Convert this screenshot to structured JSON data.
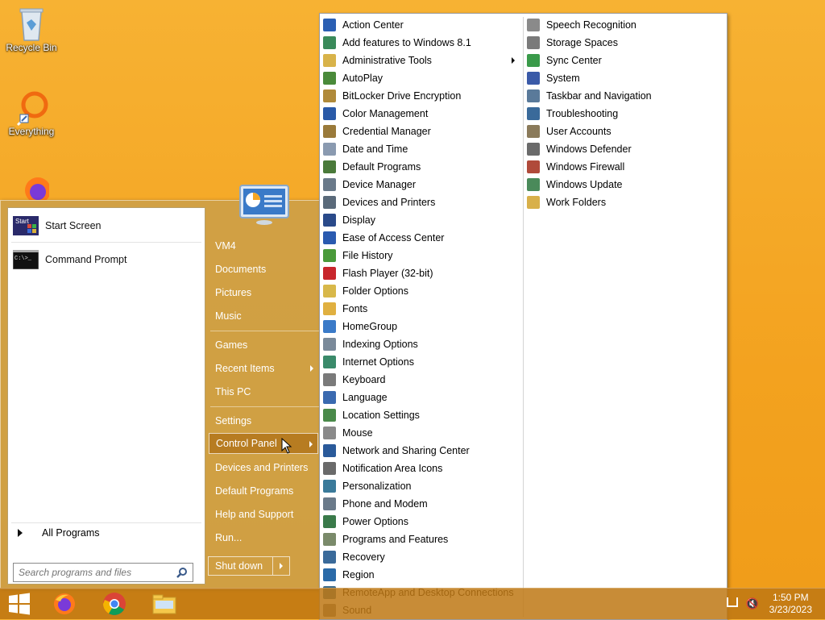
{
  "desktop": {
    "icons": [
      {
        "label": "Recycle Bin",
        "icon": "recycle-bin-icon"
      },
      {
        "label": "Everything",
        "icon": "everything-search-icon"
      },
      {
        "label": "",
        "icon": "firefox-icon"
      }
    ]
  },
  "start_menu": {
    "pinned": [
      {
        "label": "Start Screen",
        "icon": "start-screen-icon",
        "icon_text": "Start"
      },
      {
        "label": "Command Prompt",
        "icon": "command-prompt-icon",
        "icon_text": "C:\\>_"
      }
    ],
    "all_programs": "All Programs",
    "search_placeholder": "Search programs and files",
    "right_items": [
      {
        "label": "VM4"
      },
      {
        "label": "Documents"
      },
      {
        "label": "Pictures"
      },
      {
        "label": "Music"
      },
      {
        "label": "Games"
      },
      {
        "label": "Recent Items",
        "submenu": true
      },
      {
        "label": "This PC"
      },
      {
        "label": "Settings"
      },
      {
        "label": "Control Panel",
        "submenu": true,
        "active": true
      },
      {
        "label": "Devices and Printers"
      },
      {
        "label": "Default Programs"
      },
      {
        "label": "Help and Support"
      },
      {
        "label": "Run..."
      }
    ],
    "shutdown_label": "Shut down"
  },
  "control_panel_menu": {
    "column1": [
      {
        "label": "Action Center",
        "color": "#2b5fb3"
      },
      {
        "label": "Add features to Windows 8.1",
        "color": "#3a8a5a"
      },
      {
        "label": "Administrative Tools",
        "color": "#d8b34a",
        "submenu": true
      },
      {
        "label": "AutoPlay",
        "color": "#4a8a3a"
      },
      {
        "label": "BitLocker Drive Encryption",
        "color": "#b08a3a"
      },
      {
        "label": "Color Management",
        "color": "#2a5aa8"
      },
      {
        "label": "Credential Manager",
        "color": "#9a7a3a"
      },
      {
        "label": "Date and Time",
        "color": "#8a9ab0"
      },
      {
        "label": "Default Programs",
        "color": "#4a7a3a"
      },
      {
        "label": "Device Manager",
        "color": "#6a7a8a"
      },
      {
        "label": "Devices and Printers",
        "color": "#5a6a7a"
      },
      {
        "label": "Display",
        "color": "#2a4a8a"
      },
      {
        "label": "Ease of Access Center",
        "color": "#2a5ab0"
      },
      {
        "label": "File History",
        "color": "#4a9a3a"
      },
      {
        "label": "Flash Player (32-bit)",
        "color": "#c8262c"
      },
      {
        "label": "Folder Options",
        "color": "#d8b84a"
      },
      {
        "label": "Fonts",
        "color": "#e0b040"
      },
      {
        "label": "HomeGroup",
        "color": "#3a7ac8"
      },
      {
        "label": "Indexing Options",
        "color": "#7a8a9a"
      },
      {
        "label": "Internet Options",
        "color": "#3a8a6a"
      },
      {
        "label": "Keyboard",
        "color": "#7a7a7a"
      },
      {
        "label": "Language",
        "color": "#3a6ab0"
      },
      {
        "label": "Location Settings",
        "color": "#4a8a4a"
      },
      {
        "label": "Mouse",
        "color": "#8a8a8a"
      },
      {
        "label": "Network and Sharing Center",
        "color": "#2a5a9a"
      },
      {
        "label": "Notification Area Icons",
        "color": "#6a6a6a"
      },
      {
        "label": "Personalization",
        "color": "#3a7a9a"
      },
      {
        "label": "Phone and Modem",
        "color": "#6a7a8a"
      },
      {
        "label": "Power Options",
        "color": "#3a7a4a"
      },
      {
        "label": "Programs and Features",
        "color": "#7a8a6a"
      },
      {
        "label": "Recovery",
        "color": "#3a6a9a"
      },
      {
        "label": "Region",
        "color": "#2a6aa8"
      },
      {
        "label": "RemoteApp and Desktop Connections",
        "color": "#3a6a8a"
      },
      {
        "label": "Sound",
        "color": "#7a7a7a"
      }
    ],
    "column2": [
      {
        "label": "Speech Recognition",
        "color": "#8a8a8a"
      },
      {
        "label": "Storage Spaces",
        "color": "#7a7a7a"
      },
      {
        "label": "Sync Center",
        "color": "#3a9a4a"
      },
      {
        "label": "System",
        "color": "#3a5aa8"
      },
      {
        "label": "Taskbar and Navigation",
        "color": "#5a7a9a"
      },
      {
        "label": "Troubleshooting",
        "color": "#3a6a9a"
      },
      {
        "label": "User Accounts",
        "color": "#8a7a5a"
      },
      {
        "label": "Windows Defender",
        "color": "#6a6a6a"
      },
      {
        "label": "Windows Firewall",
        "color": "#b04a3a"
      },
      {
        "label": "Windows Update",
        "color": "#4a8a5a"
      },
      {
        "label": "Work Folders",
        "color": "#d8b04a"
      }
    ]
  },
  "taskbar": {
    "apps": [
      "windows-start-icon",
      "firefox-icon",
      "chrome-icon",
      "file-explorer-icon"
    ],
    "time": "1:50 PM",
    "date": "3/23/2023"
  }
}
